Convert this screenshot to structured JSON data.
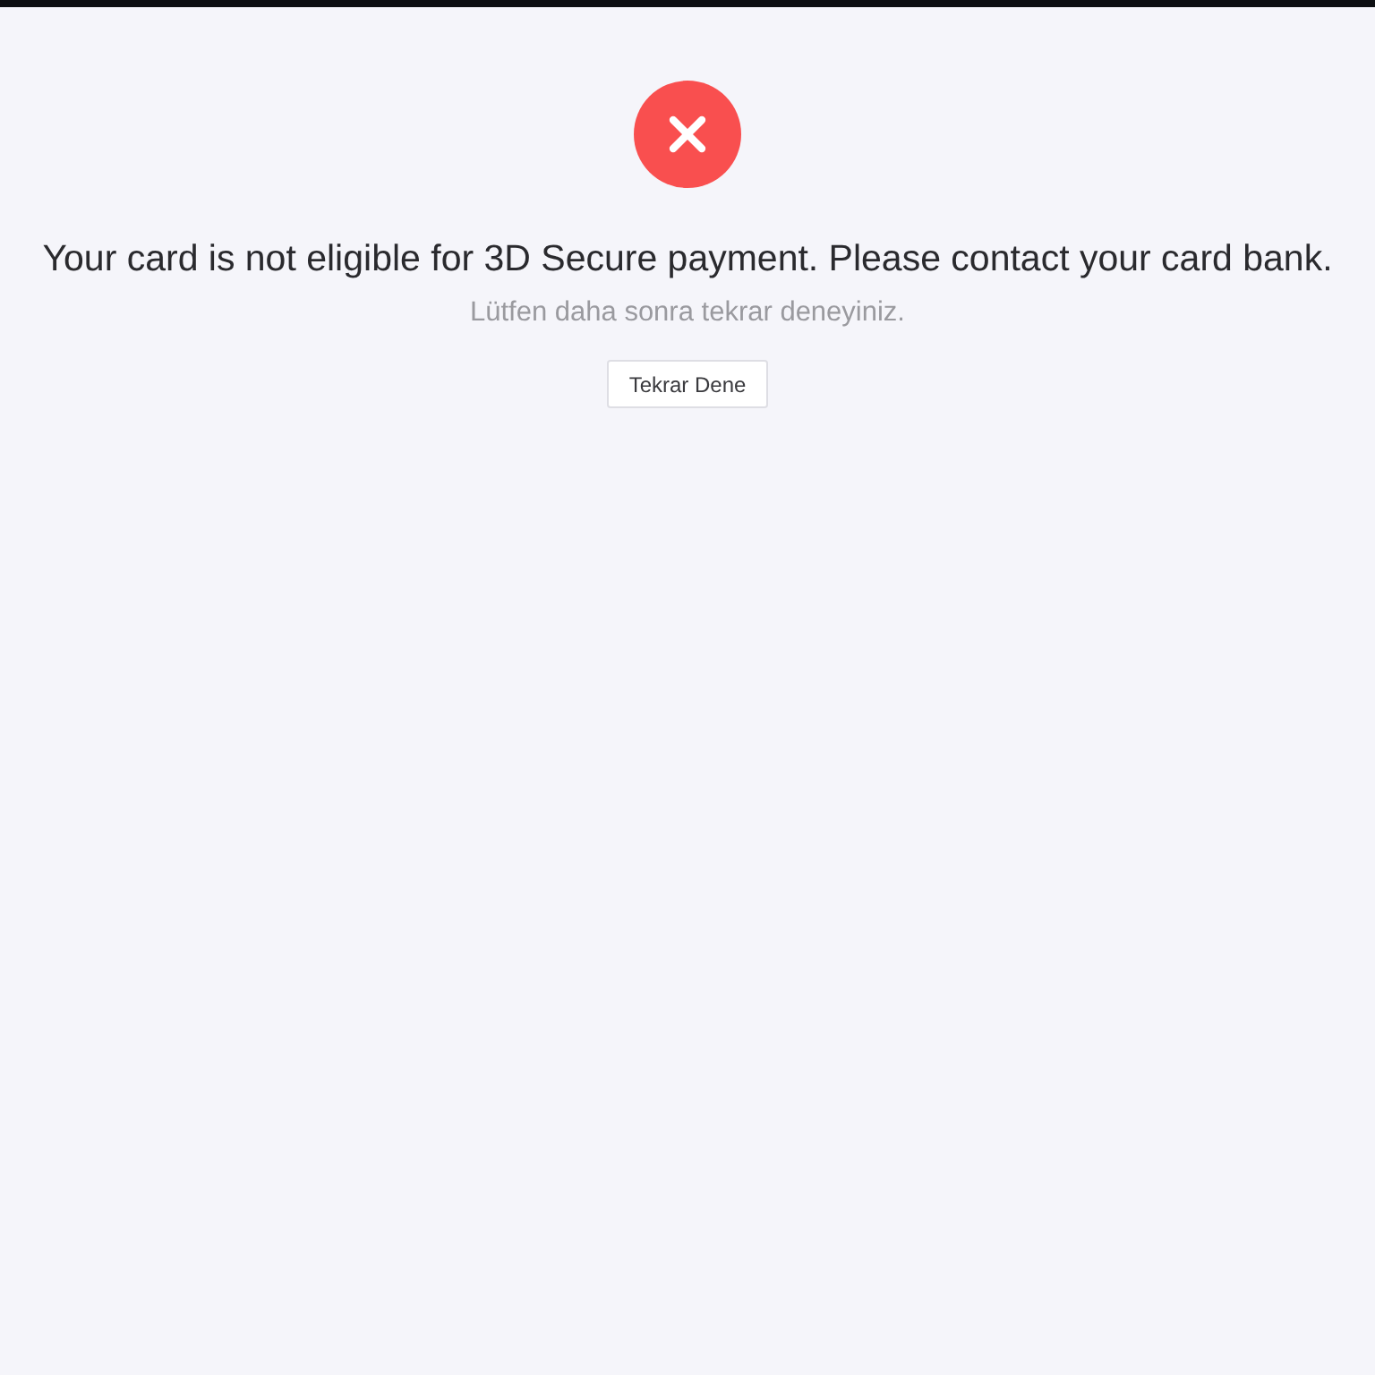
{
  "result": {
    "kind": "error",
    "title": "Your card is not eligible for 3D Secure payment. Please contact your card bank.",
    "subtitle": "Lütfen daha sonra tekrar deneyiniz."
  },
  "actions": [
    {
      "label": "Tekrar Dene"
    }
  ]
}
